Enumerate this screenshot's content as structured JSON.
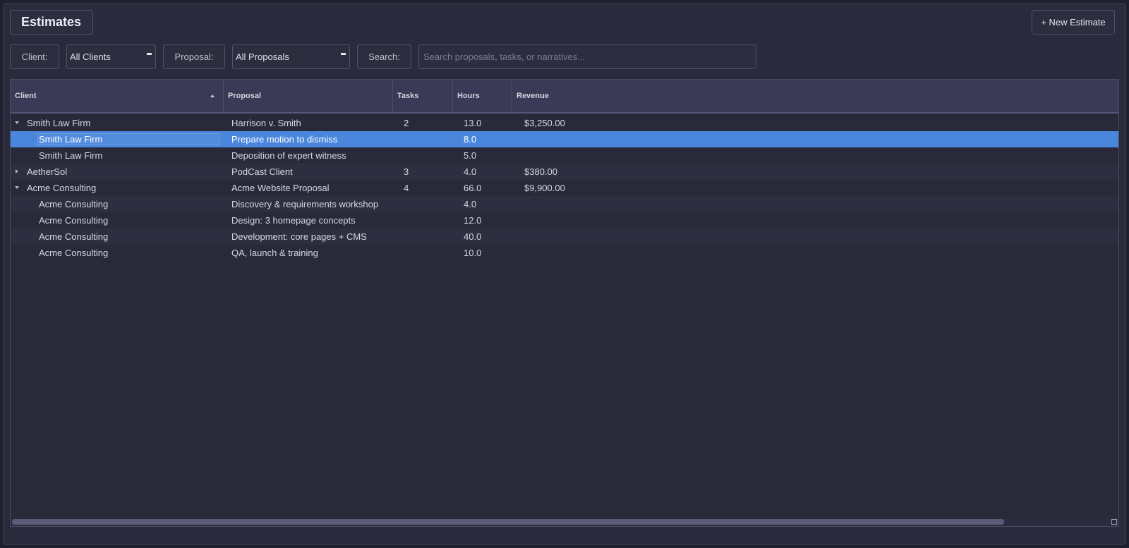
{
  "header": {
    "title": "Estimates",
    "new_button": "+ New Estimate"
  },
  "filters": {
    "client_label": "Client:",
    "client_value": "All Clients",
    "proposal_label": "Proposal:",
    "proposal_value": "All Proposals",
    "search_label": "Search:",
    "search_placeholder": "Search proposals, tasks, or narratives..."
  },
  "table": {
    "columns": [
      "Client",
      "Proposal",
      "Tasks",
      "Hours",
      "Revenue"
    ],
    "sort_column": "Client",
    "sort_direction": "ascending",
    "rows": [
      {
        "client": "Smith Law Firm",
        "proposal": "Harrison v. Smith",
        "tasks": "2",
        "hours": "13.0",
        "revenue": "$3,250.00",
        "level": 0,
        "expanded": true
      },
      {
        "client": "Smith Law Firm",
        "proposal": "Prepare motion to dismiss",
        "tasks": "",
        "hours": "8.0",
        "revenue": "",
        "level": 1,
        "selected": true
      },
      {
        "client": "Smith Law Firm",
        "proposal": "Deposition of expert witness",
        "tasks": "",
        "hours": "5.0",
        "revenue": "",
        "level": 1
      },
      {
        "client": "AetherSol",
        "proposal": "PodCast Client",
        "tasks": "3",
        "hours": "4.0",
        "revenue": "$380.00",
        "level": 0,
        "expanded": false
      },
      {
        "client": "Acme Consulting",
        "proposal": "Acme Website Proposal",
        "tasks": "4",
        "hours": "66.0",
        "revenue": "$9,900.00",
        "level": 0,
        "expanded": true
      },
      {
        "client": "Acme Consulting",
        "proposal": "Discovery & requirements workshop",
        "tasks": "",
        "hours": "4.0",
        "revenue": "",
        "level": 1
      },
      {
        "client": "Acme Consulting",
        "proposal": "Design: 3 homepage concepts",
        "tasks": "",
        "hours": "12.0",
        "revenue": "",
        "level": 1
      },
      {
        "client": "Acme Consulting",
        "proposal": "Development: core pages + CMS",
        "tasks": "",
        "hours": "40.0",
        "revenue": "",
        "level": 1
      },
      {
        "client": "Acme Consulting",
        "proposal": "QA, launch & training",
        "tasks": "",
        "hours": "10.0",
        "revenue": "",
        "level": 1
      }
    ]
  },
  "colors": {
    "background": "#2a2a3c",
    "header": "#3a3a56",
    "selection": "#4a86dc"
  }
}
